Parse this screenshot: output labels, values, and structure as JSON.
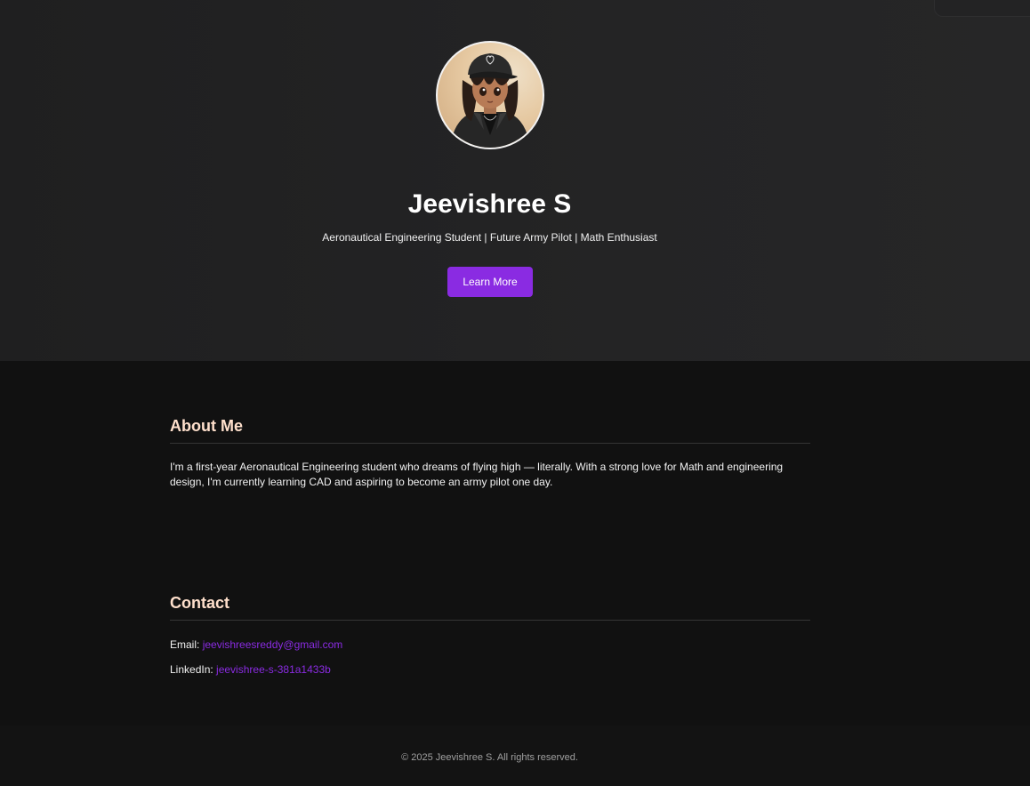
{
  "hero": {
    "name": "Jeevishree S",
    "tagline": "Aeronautical Engineering Student | Future Army Pilot | Math Enthusiast",
    "button_label": "Learn More"
  },
  "about": {
    "title": "About Me",
    "text": "I'm a first-year Aeronautical Engineering student who dreams of flying high — literally. With a strong love for Math and engineering design, I'm currently learning CAD and aspiring to become an army pilot one day."
  },
  "contact": {
    "title": "Contact",
    "email_label": "Email:",
    "email_value": "jeevishreesreddy@gmail.com",
    "linkedin_label": "LinkedIn:",
    "linkedin_value": "jeevishree-s-381a1433b"
  },
  "footer": {
    "copyright": "© 2025 Jeevishree S. All rights reserved."
  },
  "colors": {
    "accent": "#8a2be2",
    "heading": "#ffe0cc",
    "hero_bg": "#222223",
    "body_bg": "#111111"
  }
}
